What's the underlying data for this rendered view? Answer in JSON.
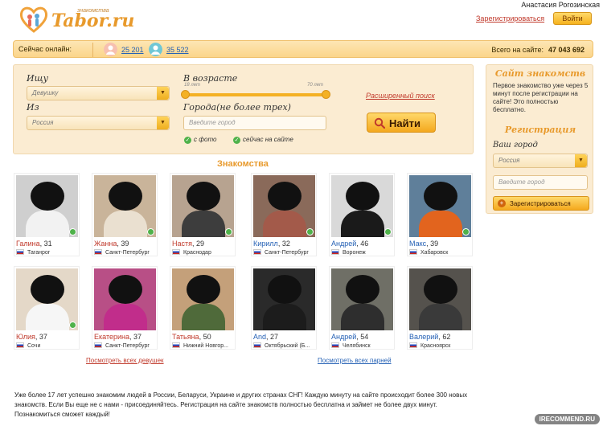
{
  "author": "Анастасия Рогозинская",
  "header": {
    "logo_sub": "знакомства",
    "logo_text": "Tabor.ru",
    "register_link": "Зарегистрироваться",
    "login_button": "Войти"
  },
  "online": {
    "label": "Сейчас онлайн:",
    "women": "25 201",
    "men": "35 522",
    "total_label": "Всего на сайте:",
    "total_value": "47 043 692"
  },
  "search": {
    "seek_label": "Ищу",
    "seek_value": "Девушку",
    "from_label": "Из",
    "from_value": "Россия",
    "age_label": "В возрасте",
    "age_min": "18 лет",
    "age_max": "70 лет",
    "age_range": [
      18,
      70
    ],
    "cities_label": "Города(не более трех)",
    "cities_placeholder": "Введите город",
    "with_photo": "с фото",
    "online_now": "сейчас на сайте",
    "advanced_link": "Расширенный поиск",
    "find_button": "Найти"
  },
  "section_title": "Знакомства",
  "profiles": [
    {
      "name": "Галина",
      "age": ", 31",
      "city": "Таганрог",
      "gender": "f"
    },
    {
      "name": "Жанна",
      "age": ", 39",
      "city": "Санкт-Петербург",
      "gender": "f"
    },
    {
      "name": "Настя",
      "age": ", 29",
      "city": "Краснодар",
      "gender": "f"
    },
    {
      "name": "Кирилл",
      "age": ", 32",
      "city": "Санкт-Петербург",
      "gender": "m"
    },
    {
      "name": "Андрей",
      "age": ", 46",
      "city": "Воронеж",
      "gender": "m"
    },
    {
      "name": "Макс",
      "age": ", 39",
      "city": "Хабаровск",
      "gender": "m"
    },
    {
      "name": "Юлия",
      "age": ", 37",
      "city": "Сочи",
      "gender": "f"
    },
    {
      "name": "Екатерина",
      "age": ", 37",
      "city": "Санкт-Петербург",
      "gender": "f"
    },
    {
      "name": "Татьяна",
      "age": ", 50",
      "city": "Нижний Новгор...",
      "gender": "f"
    },
    {
      "name": "And",
      "age": ", 27",
      "city": "Октябрьский (Б...",
      "gender": "m"
    },
    {
      "name": "Андрей",
      "age": ", 54",
      "city": "Челябинск",
      "gender": "m"
    },
    {
      "name": "Валерий",
      "age": ", 62",
      "city": "Красноярск",
      "gender": "m"
    }
  ],
  "see_all_women": "Посмотреть всех девушек",
  "see_all_men": "Посмотреть всех парней",
  "sidebar": {
    "title": "Сайт знакомств",
    "text": "Первое знакомство уже через 5 минут после регистрации на сайте! Это полностью бесплатно.",
    "reg_title": "Регистрация",
    "city_label": "Ваш город",
    "country_value": "Россия",
    "city_placeholder": "Введите город",
    "register_button": "Зарегистрироваться"
  },
  "footer_text": "Уже более 17 лет успешно знакомим людей в России, Беларуси, Украине и других странах СНГ! Каждую минуту на сайте происходит более 300 новых знакомств. Если Вы еще не с нами - присоединяйтесь. Регистрация на сайте знакомств полностью бесплатна и займет не более двух минут. Познакомиться сможет каждый!",
  "watermark": "IRECOMMEND.RU",
  "colors": {
    "accent": "#e89a2c",
    "link_red": "#c0392b",
    "link_blue": "#2561b5",
    "panel": "#fbecd2"
  }
}
